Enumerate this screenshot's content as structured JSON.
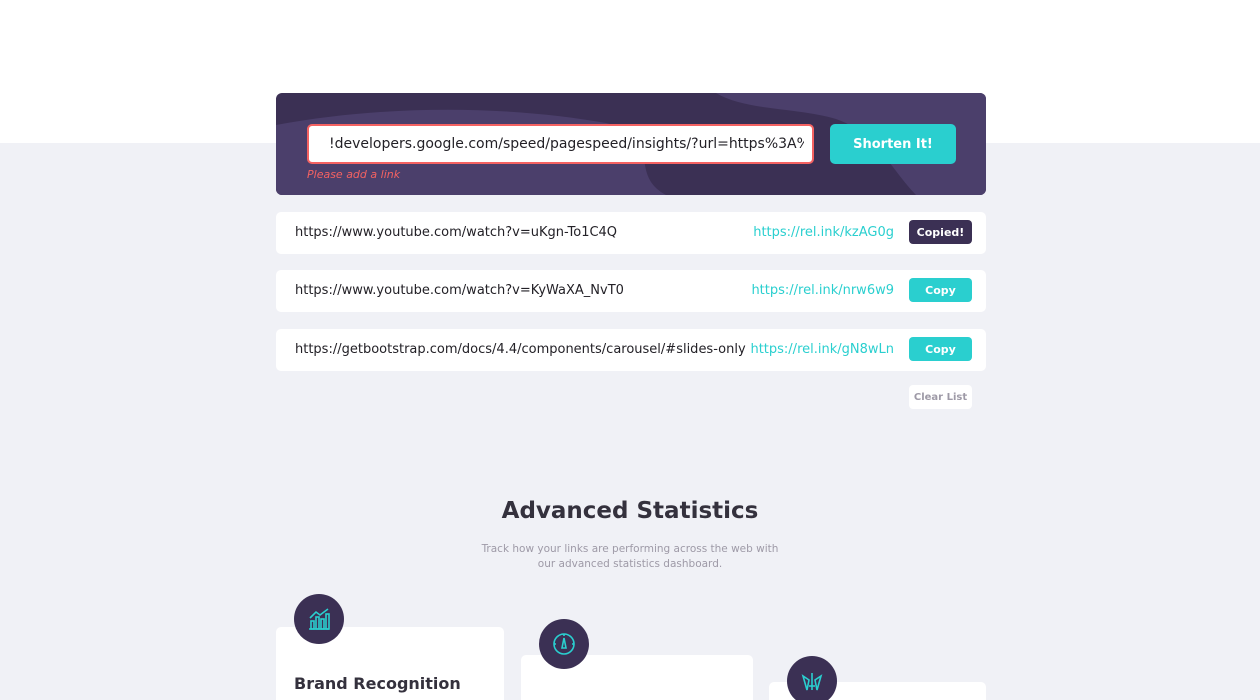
{
  "shortener": {
    "input_value": "!developers.google.com/speed/pagespeed/insights/?url=https%3A%2F%",
    "error": "Please add a link",
    "submit_label": "Shorten It!"
  },
  "links": [
    {
      "original": "https://www.youtube.com/watch?v=uKgn-To1C4Q",
      "short": "https://rel.ink/kzAG0g",
      "button": "Copied!"
    },
    {
      "original": "https://www.youtube.com/watch?v=KyWaXA_NvT0",
      "short": "https://rel.ink/nrw6w9",
      "button": "Copy"
    },
    {
      "original": "https://getbootstrap.com/docs/4.4/components/carousel/#slides-only",
      "short": "https://rel.ink/gN8wLn",
      "button": "Copy"
    }
  ],
  "clear_label": "Clear List",
  "stats": {
    "title": "Advanced Statistics",
    "description": "Track how your links are performing across the web with our advanced statistics dashboard."
  },
  "cards": [
    {
      "title": "Brand Recognition",
      "icon": "bar-chart-icon"
    },
    {
      "title": "",
      "icon": "speedometer-icon"
    },
    {
      "title": "",
      "icon": "pen-tools-icon"
    }
  ],
  "colors": {
    "accent": "#2acfcf",
    "dark_violet": "#3b3054",
    "error": "#f46262",
    "background": "#f0f1f6"
  }
}
